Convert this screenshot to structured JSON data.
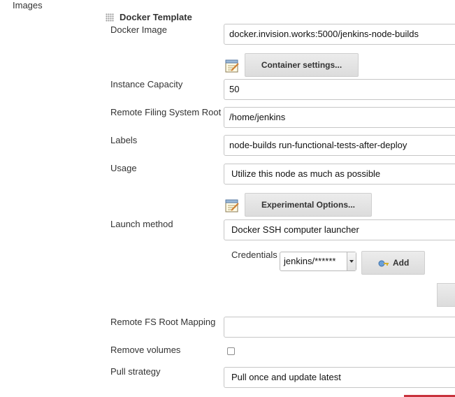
{
  "section": {
    "label": "Images"
  },
  "template": {
    "title": "Docker Template"
  },
  "fields": {
    "docker_image": {
      "label": "Docker Image",
      "value": "docker.invision.works:5000/jenkins-node-builds"
    },
    "container_settings_button": "Container settings...",
    "instance_capacity": {
      "label": "Instance Capacity",
      "value": "50"
    },
    "remote_fs_root": {
      "label": "Remote Filing System Root",
      "value": "/home/jenkins"
    },
    "labels": {
      "label": "Labels",
      "value": "node-builds run-functional-tests-after-deploy"
    },
    "usage": {
      "label": "Usage",
      "value": "Utilize this node as much as possible"
    },
    "experimental_options_button": "Experimental Options...",
    "launch_method": {
      "label": "Launch method",
      "value": "Docker SSH computer launcher"
    },
    "credentials": {
      "label": "Credentials",
      "value": "jenkins/******",
      "add_button": "Add"
    },
    "remote_fs_root_mapping": {
      "label": "Remote FS Root Mapping",
      "value": ""
    },
    "remove_volumes": {
      "label": "Remove volumes",
      "checked": false
    },
    "pull_strategy": {
      "label": "Pull strategy",
      "value": "Pull once and update latest"
    }
  },
  "icons": {
    "notepad": "notepad-icon",
    "key": "key-icon",
    "grip": "drag-handle-icon",
    "dropdown": "chevron-down-icon"
  },
  "colors": {
    "accent_red": "#c8323c",
    "button_bg": "#e4e4e4",
    "field_border": "#c6c6c6"
  }
}
